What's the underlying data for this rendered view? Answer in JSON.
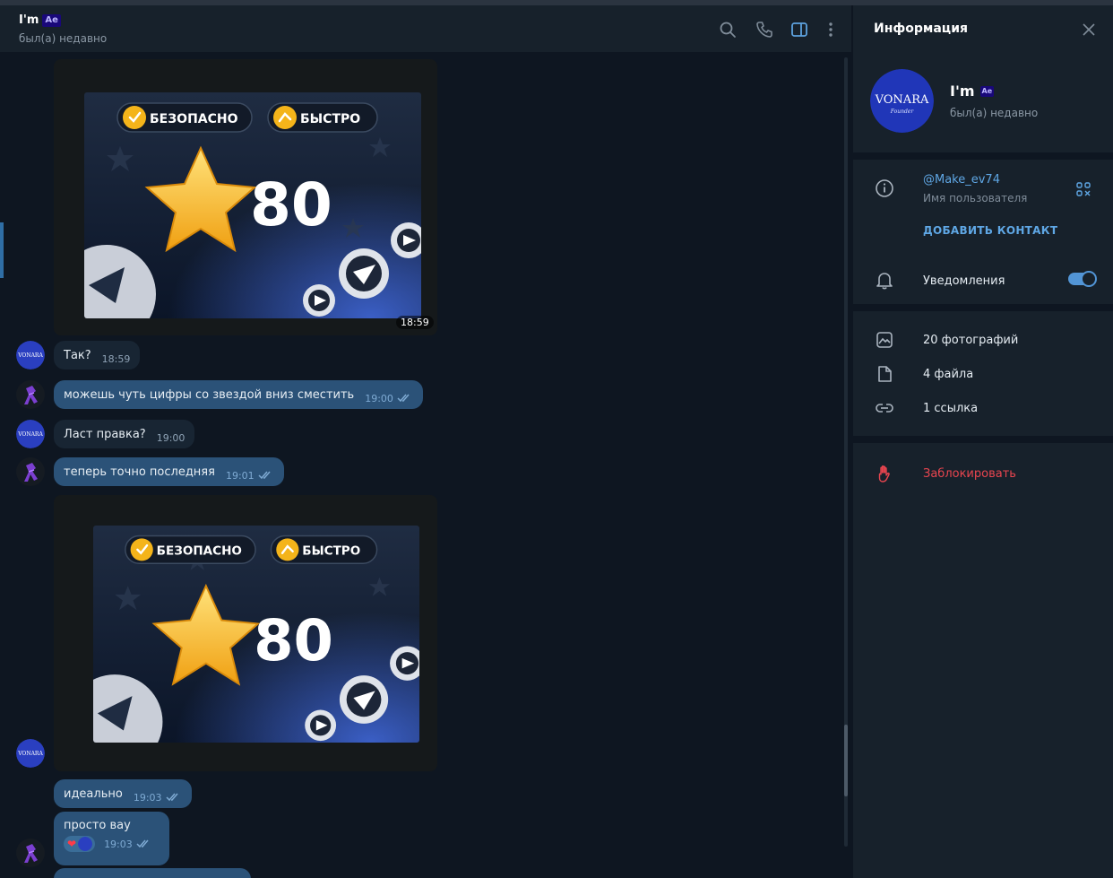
{
  "chat": {
    "title": "I'm",
    "title_badge": "Ae",
    "status": "был(а) недавно"
  },
  "header_icons": [
    "search-icon",
    "phone-icon",
    "sidebar-toggle-icon",
    "more-vertical-icon"
  ],
  "stickers": [
    {
      "badge_left": "БЕЗОПАСНО",
      "badge_right": "БЫСТРО",
      "number": "80",
      "time": "18:59"
    },
    {
      "badge_left": "БЕЗОПАСНО",
      "badge_right": "БЫСТРО",
      "number": "80",
      "time": ""
    }
  ],
  "avatar_text": {
    "main": "VONARA",
    "sub": "Founder"
  },
  "messages": [
    {
      "direction": "in",
      "text": "Так?",
      "time": "18:59"
    },
    {
      "direction": "out",
      "text": "можешь чуть цифры со звездой вниз сместить",
      "time": "19:00"
    },
    {
      "direction": "in",
      "text": "Ласт правка?",
      "time": "19:00"
    },
    {
      "direction": "out",
      "text": "теперь точно последняя",
      "time": "19:01"
    },
    {
      "direction": "out",
      "text": "идеально",
      "time": "19:03"
    },
    {
      "direction": "out",
      "text": "просто вау",
      "time": "19:03",
      "reaction": "heart"
    }
  ],
  "info": {
    "title": "Информация",
    "name": "I'm",
    "name_badge": "Ae",
    "status": "был(а) недавно",
    "username": "@Make_ev74",
    "username_caption": "Имя пользователя",
    "add_contact": "ДОБАВИТЬ КОНТАКТ",
    "notifications": "Уведомления",
    "notifications_on": true,
    "photos": "20 фотографий",
    "files": "4 файла",
    "links": "1 ссылка",
    "block": "Заблокировать"
  },
  "colors": {
    "chat_bg": "#0e1621",
    "panel_bg": "#17212b",
    "bubble_in": "#182533",
    "bubble_out": "#2b5278",
    "link": "#5fa7e5",
    "danger": "#e8454f"
  }
}
